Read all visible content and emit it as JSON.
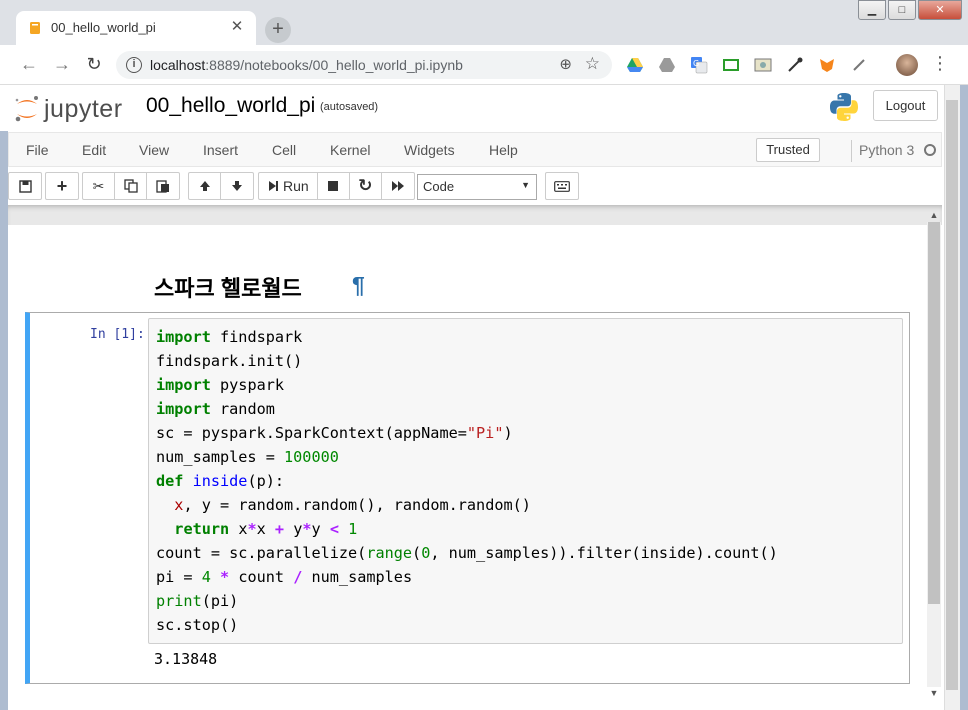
{
  "browser": {
    "tab_title": "00_hello_world_pi",
    "tab_close": "✕",
    "new_tab": "+",
    "window_controls": {
      "minimize": "▭",
      "maximize": "□",
      "close": "✕"
    },
    "url_host": "localhost",
    "url_rest": ":8889/notebooks/00_hello_world_pi.ipynb",
    "back": "←",
    "forward": "→",
    "reload": "↻",
    "zoom_icon": "⊕",
    "star_icon": "☆",
    "menu_icon": "⋮"
  },
  "jupyter": {
    "logo_text": "jupyter",
    "notebook_name": "00_hello_world_pi",
    "autosave": "(autosaved)",
    "logout": "Logout",
    "menus": [
      "File",
      "Edit",
      "View",
      "Insert",
      "Cell",
      "Kernel",
      "Widgets",
      "Help"
    ],
    "trusted": "Trusted",
    "kernel": "Python 3",
    "toolbar": {
      "save": "💾",
      "add": "+",
      "cut": "✂",
      "copy": "⎘",
      "paste": "📋",
      "up": "▲",
      "down": "▼",
      "run_icon": "⏭",
      "run": "Run",
      "stop": "■",
      "restart": "↻",
      "restart_run": "⏩",
      "celltype": "Code",
      "keyboard": "⌨"
    }
  },
  "notebook": {
    "markdown_heading": "스파크 헬로월드",
    "anchor": "¶",
    "prompt": "In [1]:",
    "output": "3.13848",
    "code_lines": [
      "import findspark",
      "findspark.init()",
      "import pyspark",
      "import random",
      "sc = pyspark.SparkContext(appName=\"Pi\")",
      "num_samples = 100000",
      "def inside(p):",
      "  x, y = random.random(), random.random()",
      "  return x*x + y*y < 1",
      "count = sc.parallelize(range(0, num_samples)).filter(inside).count()",
      "pi = 4 * count / num_samples",
      "print(pi)",
      "sc.stop()"
    ]
  }
}
